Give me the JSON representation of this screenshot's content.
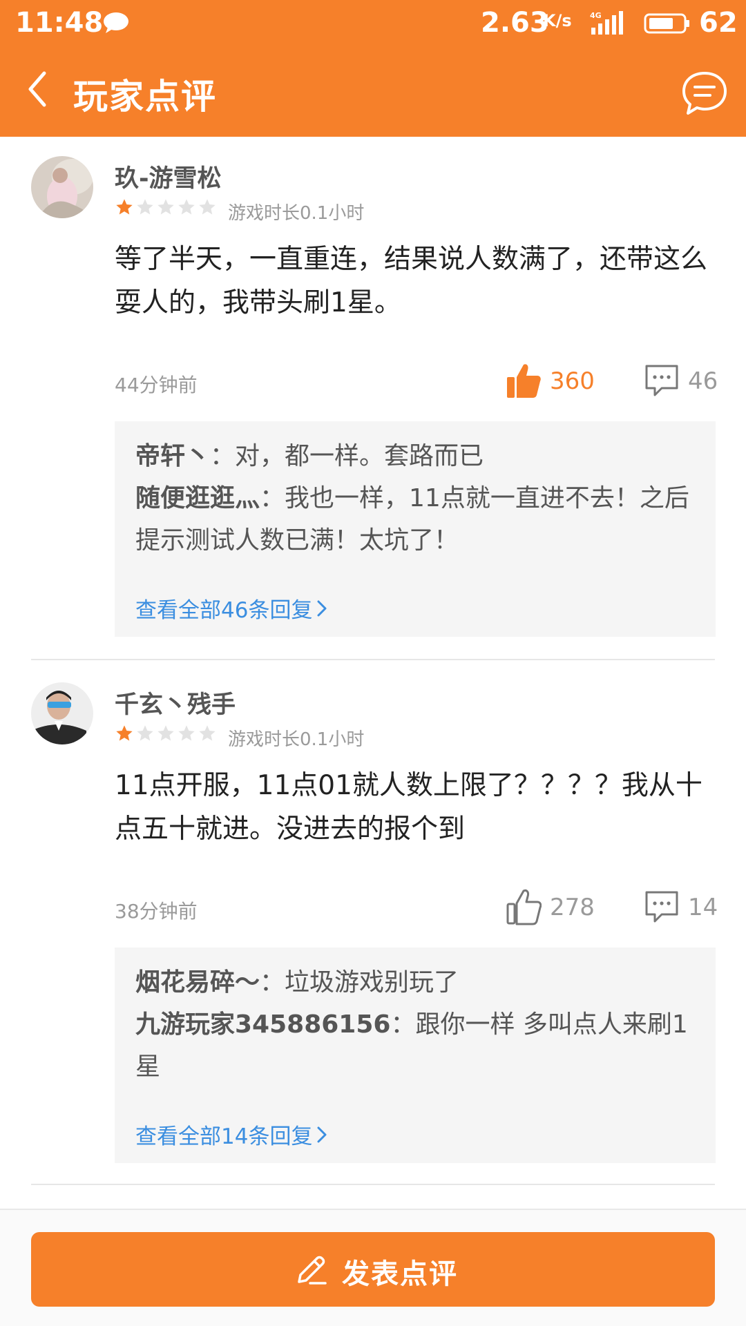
{
  "status_bar": {
    "time": "11:48",
    "net_speed": "2.63",
    "net_speed_unit": "K/s",
    "battery": "62"
  },
  "header": {
    "title": "玩家点评"
  },
  "reviews": [
    {
      "username": "玖-游雪松",
      "rating": 1,
      "playtime": "游戏时长0.1小时",
      "text": "等了半天，一直重连，结果说人数满了，还带这么耍人的，我带头刷1星。",
      "time": "44分钟前",
      "likes": "360",
      "liked": true,
      "comments": "46",
      "replies": [
        {
          "user": "帝轩丶",
          "text": "：对，都一样。套路而已"
        },
        {
          "user": "随便逛逛灬",
          "text": "：我也一样，11点就一直进不去！之后提示测试人数已满！太坑了！"
        }
      ],
      "view_all": "查看全部46条回复"
    },
    {
      "username": "千玄丶残手",
      "rating": 1,
      "playtime": "游戏时长0.1小时",
      "text": "11点开服，11点01就人数上限了？？？？我从十点五十就进。没进去的报个到",
      "time": "38分钟前",
      "likes": "278",
      "liked": false,
      "comments": "14",
      "replies": [
        {
          "user": "烟花易碎〜",
          "text": "：垃圾游戏别玩了"
        },
        {
          "user": "九游玩家345886156",
          "text": "：跟你一样  多叫点人来刷1星"
        }
      ],
      "view_all": "查看全部14条回复"
    }
  ],
  "bottom": {
    "post_label": "发表点评"
  },
  "colors": {
    "accent": "#f6802a",
    "link": "#3b8ee0",
    "star_on": "#f6802a",
    "star_off": "#e2e2e2"
  },
  "icons": [
    "message-icon",
    "signal-icon",
    "battery-icon",
    "back-icon",
    "chat-icon",
    "star-icon",
    "thumbs-up-icon",
    "comment-icon",
    "chevron-right-icon",
    "pen-icon"
  ]
}
